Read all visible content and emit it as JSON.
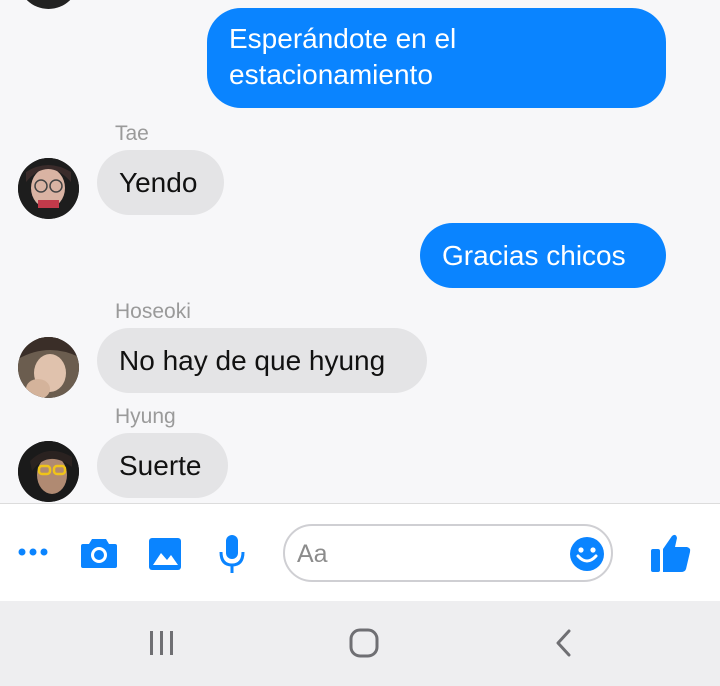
{
  "messages": {
    "out1": "Esperándote en el estacionamiento",
    "tae_name": "Tae",
    "tae_msg": "Yendo",
    "out2": "Gracias chicos",
    "hoseoki_name": "Hoseoki",
    "hoseoki_msg": "No hay de que hyung",
    "hyung_name": "Hyung",
    "hyung_msg": "Suerte"
  },
  "composer": {
    "placeholder": "Aa",
    "icons": [
      "more-icon",
      "camera-icon",
      "image-icon",
      "microphone-icon",
      "emoji-icon",
      "thumbs-up-icon"
    ]
  },
  "navbar": {
    "icons": [
      "recent-apps-icon",
      "home-icon",
      "back-icon"
    ]
  },
  "colors": {
    "accent": "#0a84ff",
    "incoming_bubble": "#e4e4e6",
    "background": "#f7f7f9"
  }
}
